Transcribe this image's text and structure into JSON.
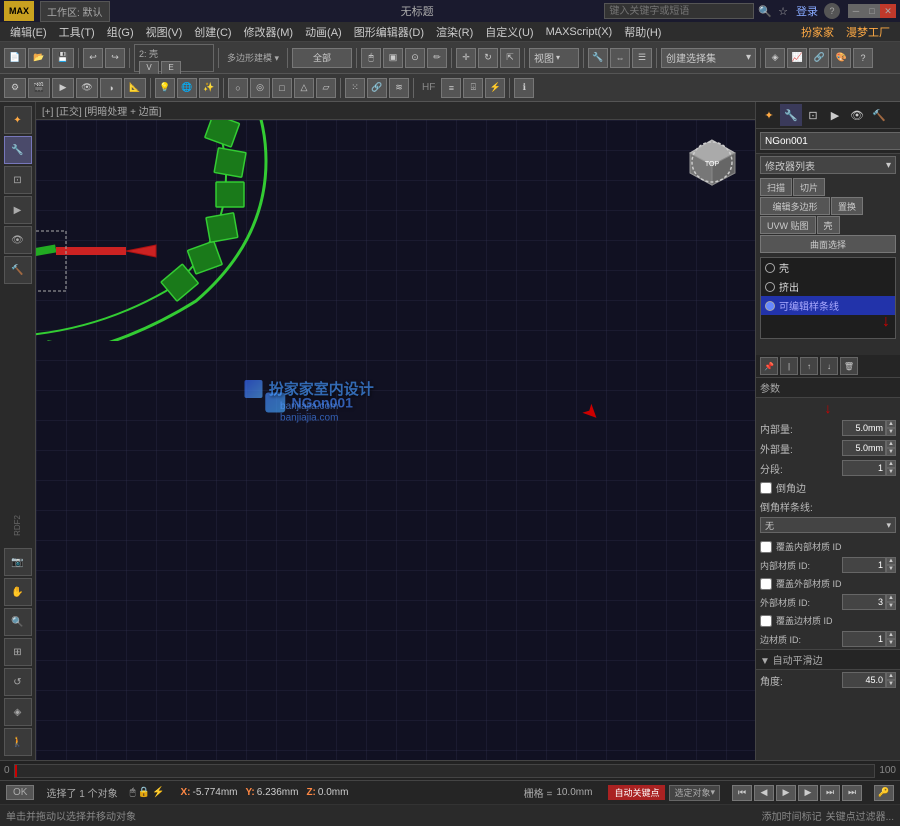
{
  "titlebar": {
    "logo": "MAX",
    "workspace": "工作区: 默认",
    "filename": "无标题",
    "search_placeholder": "键入关键字或短语",
    "login": "登录",
    "controls": [
      "_",
      "□",
      "×"
    ]
  },
  "menubar": {
    "items": [
      "编辑(E)",
      "工具(T)",
      "组(G)",
      "视图(V)",
      "创建(C)",
      "修改器(M)",
      "动画(A)",
      "图形编辑器(D)",
      "渲染(R)",
      "自定义(U)",
      "MAXScript(X)",
      "帮助(H)",
      "扮家家",
      "漫梦工厂"
    ]
  },
  "viewport": {
    "label": "[+] [正交] [明暗处理 + 边面]",
    "mode": "RDF2",
    "watermark_text": "扮家家室内设计",
    "watermark_url": "banjiajia.com",
    "grid_label": "视图"
  },
  "right_panel": {
    "object_name": "NGon001",
    "object_color": "#00aa00",
    "modifier_list_label": "修改器列表",
    "scan_label": "扫描",
    "cut_label": "切片",
    "edit_poly_label": "编辑多边形",
    "replace_label": "置换",
    "uvw_label": "UVW 贴图",
    "shell_label": "壳",
    "surface_select_label": "曲面选择",
    "modifiers": [
      {
        "name": "壳",
        "active": true
      },
      {
        "name": "挤出",
        "active": false
      },
      {
        "name": "可编辑样条线",
        "active": false,
        "selected": true
      }
    ],
    "params_title": "参数",
    "inner_amount_label": "内部量:",
    "inner_amount_value": "5.0mm",
    "outer_amount_label": "外部量:",
    "outer_amount_value": "5.0mm",
    "segments_label": "分段:",
    "segments_value": "1",
    "bevel_label": "倒角边",
    "bevel_spline_label": "倒角样条线:",
    "bevel_spline_value": "无",
    "cover_inner_mat_label": "覆盖内部材质 ID",
    "inner_mat_id_label": "内部材质 ID:",
    "inner_mat_id_value": "1",
    "cover_outer_mat_label": "覆盖外部材质 ID",
    "outer_mat_id_label": "外部材质 ID:",
    "outer_mat_id_value": "3",
    "cover_edge_mat_label": "覆盖边材质 ID",
    "edge_mat_id_label": "边材质 ID:",
    "edge_mat_id_value": "1",
    "auto_smooth_label": "▼ 自动平滑边",
    "angle_label": "角度:",
    "angle_value": "45.0"
  },
  "statusbar": {
    "selected": "选择了 1 个对象",
    "x_label": "X:",
    "x_val": "-5.774mm",
    "y_label": "Y:",
    "y_val": "6.236mm",
    "z_label": "Z:",
    "z_val": "0.0mm",
    "grid_label": "栅格 =",
    "grid_val": "10.0mm",
    "auto_key": "自动关键点",
    "selected_objects": "选定对象"
  },
  "statusbar2": {
    "message": "单击并拖动以选择并移动对象",
    "add_tag": "添加时间标记"
  },
  "ok_btn": "OK",
  "toolbar_items": {
    "undo": "↩",
    "redo": "↪",
    "select_all": "全部",
    "view_label": "视图"
  }
}
